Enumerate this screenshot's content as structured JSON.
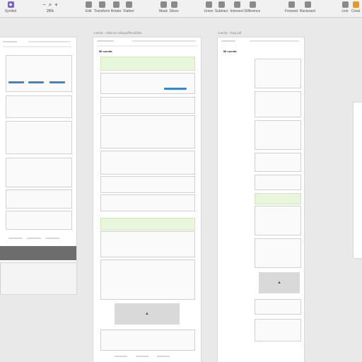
{
  "toolbar": {
    "symbol": {
      "label": "Symbol",
      "icon": "symbol-icon"
    },
    "zoom": {
      "minus": "−",
      "plus": "+",
      "percent": "25%"
    },
    "items": [
      {
        "label": "Edit",
        "icon": "edit-icon"
      },
      {
        "label": "Transform",
        "icon": "transform-icon"
      },
      {
        "label": "Rotate",
        "icon": "rotate-icon"
      },
      {
        "label": "Flatten",
        "icon": "flatten-icon"
      },
      {
        "label": "Mask",
        "icon": "mask-icon"
      },
      {
        "label": "Slices",
        "icon": "slice-icon"
      },
      {
        "label": "Union",
        "icon": "union-icon"
      },
      {
        "label": "Subtract",
        "icon": "subtract-icon"
      },
      {
        "label": "Intersect",
        "icon": "intersect-icon"
      },
      {
        "label": "Difference",
        "icon": "difference-icon"
      },
      {
        "label": "Forward",
        "icon": "forward-icon"
      },
      {
        "label": "Backward",
        "icon": "backward-icon"
      },
      {
        "label": "Link",
        "icon": "link-icon"
      },
      {
        "label": "Creat",
        "icon": "create-icon"
      }
    ]
  },
  "artboards": [
    {
      "title": ""
    },
    {
      "title": "cuenta - vista sin ubiqua/flexiobble"
    },
    {
      "title": "cuenta - hoja pdf"
    }
  ],
  "artboard_headings": {
    "mi_cuenta_1": "Mi cuenta",
    "mi_cuenta_2": "Mi cuenta"
  },
  "colors": {
    "accent": "#3d86c6",
    "promo": "#e8f6dc",
    "footer": "#6d6d6d"
  }
}
